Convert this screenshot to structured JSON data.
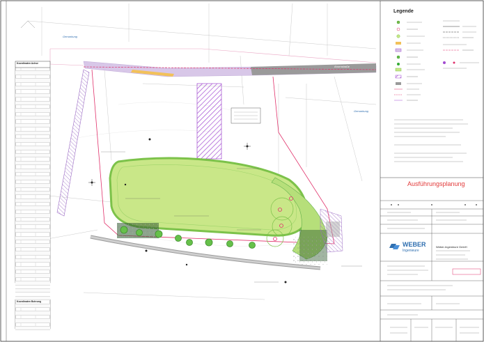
{
  "map": {
    "legend_title": "Legende",
    "road_label": "Ahornstraße",
    "sheet_title": "Ausführungsplanung",
    "company_name": "WEBER",
    "company_sub": "Ingenieure",
    "company_full": "Weber-Ingenieure GmbH",
    "parcel_label_left": "Gemarkung",
    "parcel_label_right": "Gemarkung",
    "coord_table_title": "Koordinaten Achse",
    "coord_table_title2": "Koordinaten Bohrung",
    "colors": {
      "lawn": "#c9e788",
      "lawn_border": "#7cc24a",
      "hatch": "#a24bd1",
      "road": "#9a9a9a",
      "boundary": "#e0306a",
      "title_red": "#e23b3b"
    }
  }
}
